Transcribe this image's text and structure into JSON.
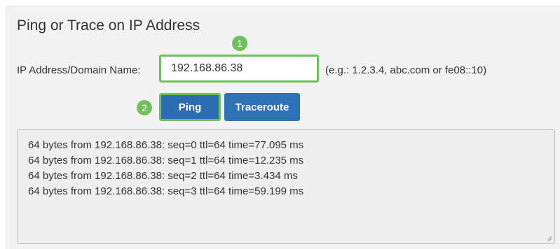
{
  "title": "Ping or Trace on IP Address",
  "address_field": {
    "label": "IP Address/Domain Name:",
    "value": "192.168.86.38",
    "hint": "(e.g.: 1.2.3.4, abc.com or fe08::10)"
  },
  "callouts": {
    "step1": "1",
    "step2": "2"
  },
  "buttons": {
    "ping": "Ping",
    "traceroute": "Traceroute"
  },
  "output": {
    "lines": [
      "64 bytes from 192.168.86.38: seq=0 ttl=64 time=77.095 ms",
      "64 bytes from 192.168.86.38: seq=1 ttl=64 time=12.235 ms",
      "64 bytes from 192.168.86.38: seq=2 ttl=64 time=3.434 ms",
      "64 bytes from 192.168.86.38: seq=3 ttl=64 time=59.199 ms"
    ]
  },
  "colors": {
    "highlight": "#6fc05f",
    "button": "#2c6db2",
    "panel": "#f2f2f2"
  }
}
